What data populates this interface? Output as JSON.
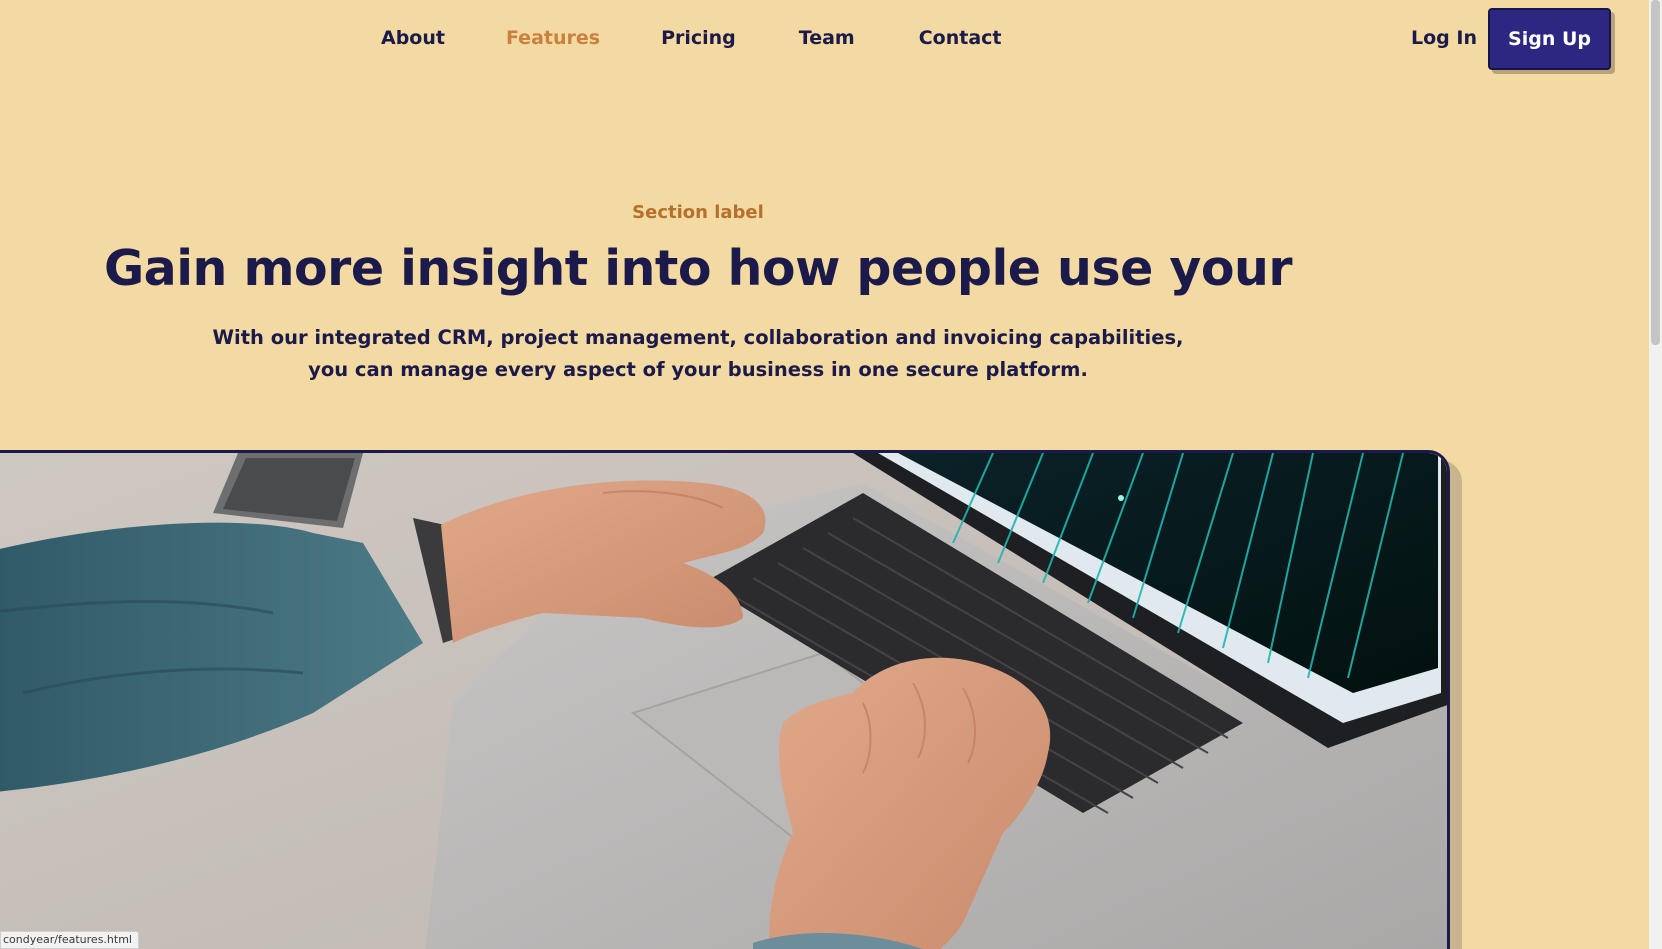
{
  "nav": {
    "links": [
      {
        "label": "About",
        "active": false
      },
      {
        "label": "Features",
        "active": true
      },
      {
        "label": "Pricing",
        "active": false
      },
      {
        "label": "Team",
        "active": false
      },
      {
        "label": "Contact",
        "active": false
      }
    ],
    "login_label": "Log In",
    "signup_label": "Sign Up"
  },
  "hero": {
    "section_label": "Section label",
    "title": "Gain more insight into how people use your",
    "subtitle": "With our integrated CRM, project management, collaboration and invoicing capabilities, you can manage every aspect of your business in one secure platform."
  },
  "status_bar": {
    "url": "condyear/features.html"
  },
  "colors": {
    "background": "#f2daa2",
    "text": "#1b1a4a",
    "accent": "#c8823e",
    "primary_button": "#2c2780"
  }
}
